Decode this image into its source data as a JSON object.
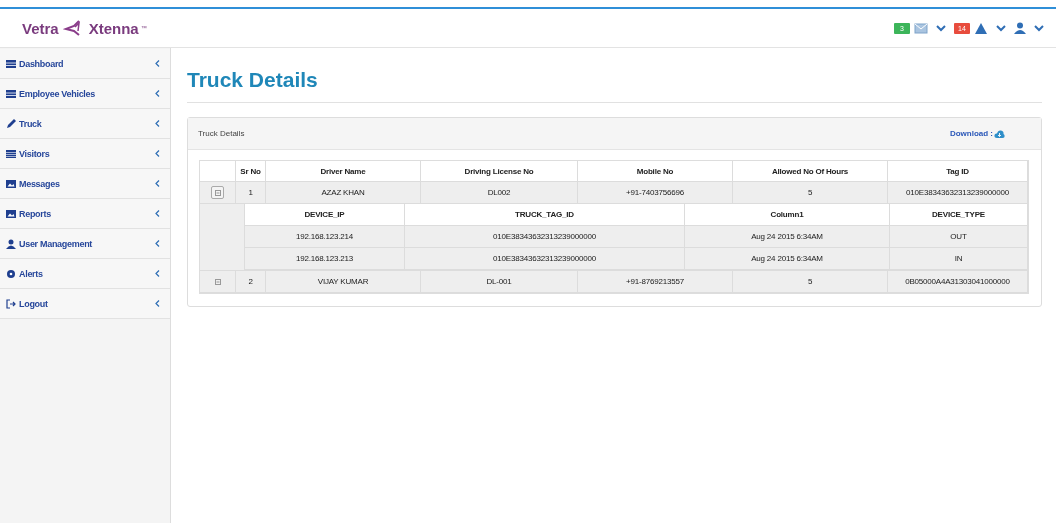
{
  "logo": {
    "left": "Vetra",
    "right": "Xtenna",
    "mark": "™"
  },
  "header_badges": [
    {
      "count": "3",
      "color": "#3cb55a"
    },
    {
      "count": "14",
      "color": "#e84c3d"
    }
  ],
  "sidebar": {
    "items": [
      {
        "label": "Dashboard",
        "selected": false
      },
      {
        "label": "Employee Vehicles",
        "selected": false
      },
      {
        "label": "Truck",
        "selected": false
      },
      {
        "label": "Visitors",
        "selected": false
      },
      {
        "label": "Messages",
        "selected": false
      },
      {
        "label": "Reports",
        "selected": false
      },
      {
        "label": "User Management",
        "selected": false
      },
      {
        "label": "Alerts",
        "selected": false
      },
      {
        "label": "Logout",
        "selected": false
      }
    ]
  },
  "page_title": "Truck Details",
  "panel": {
    "title": "Truck Details",
    "download": "Download :"
  },
  "table": {
    "columns": [
      "Sr No",
      "Driver Name",
      "Driving License No",
      "Mobile No",
      "Allowed No Of Hours",
      "Tag ID"
    ],
    "rows": [
      {
        "expanded": true,
        "cells": [
          "1",
          "AZAZ KHAN",
          "DL002",
          "+91-7403756696",
          "5",
          "010E38343632313239000000"
        ],
        "detail": {
          "columns": [
            "DEVICE_IP",
            "TRUCK_TAG_ID",
            "Column1",
            "DEVICE_TYPE"
          ],
          "rows": [
            [
              "192.168.123.214",
              "010E38343632313239000000",
              "Aug 24 2015 6:34AM",
              "OUT"
            ],
            [
              "192.168.123.213",
              "010E38343632313239000000",
              "Aug 24 2015 6:34AM",
              "IN"
            ]
          ]
        }
      },
      {
        "expanded": false,
        "cells": [
          "2",
          "VIJAY KUMAR",
          "DL-001",
          "+91-8769213557",
          "5",
          "0B05000A4A31303041000000"
        ]
      }
    ]
  }
}
